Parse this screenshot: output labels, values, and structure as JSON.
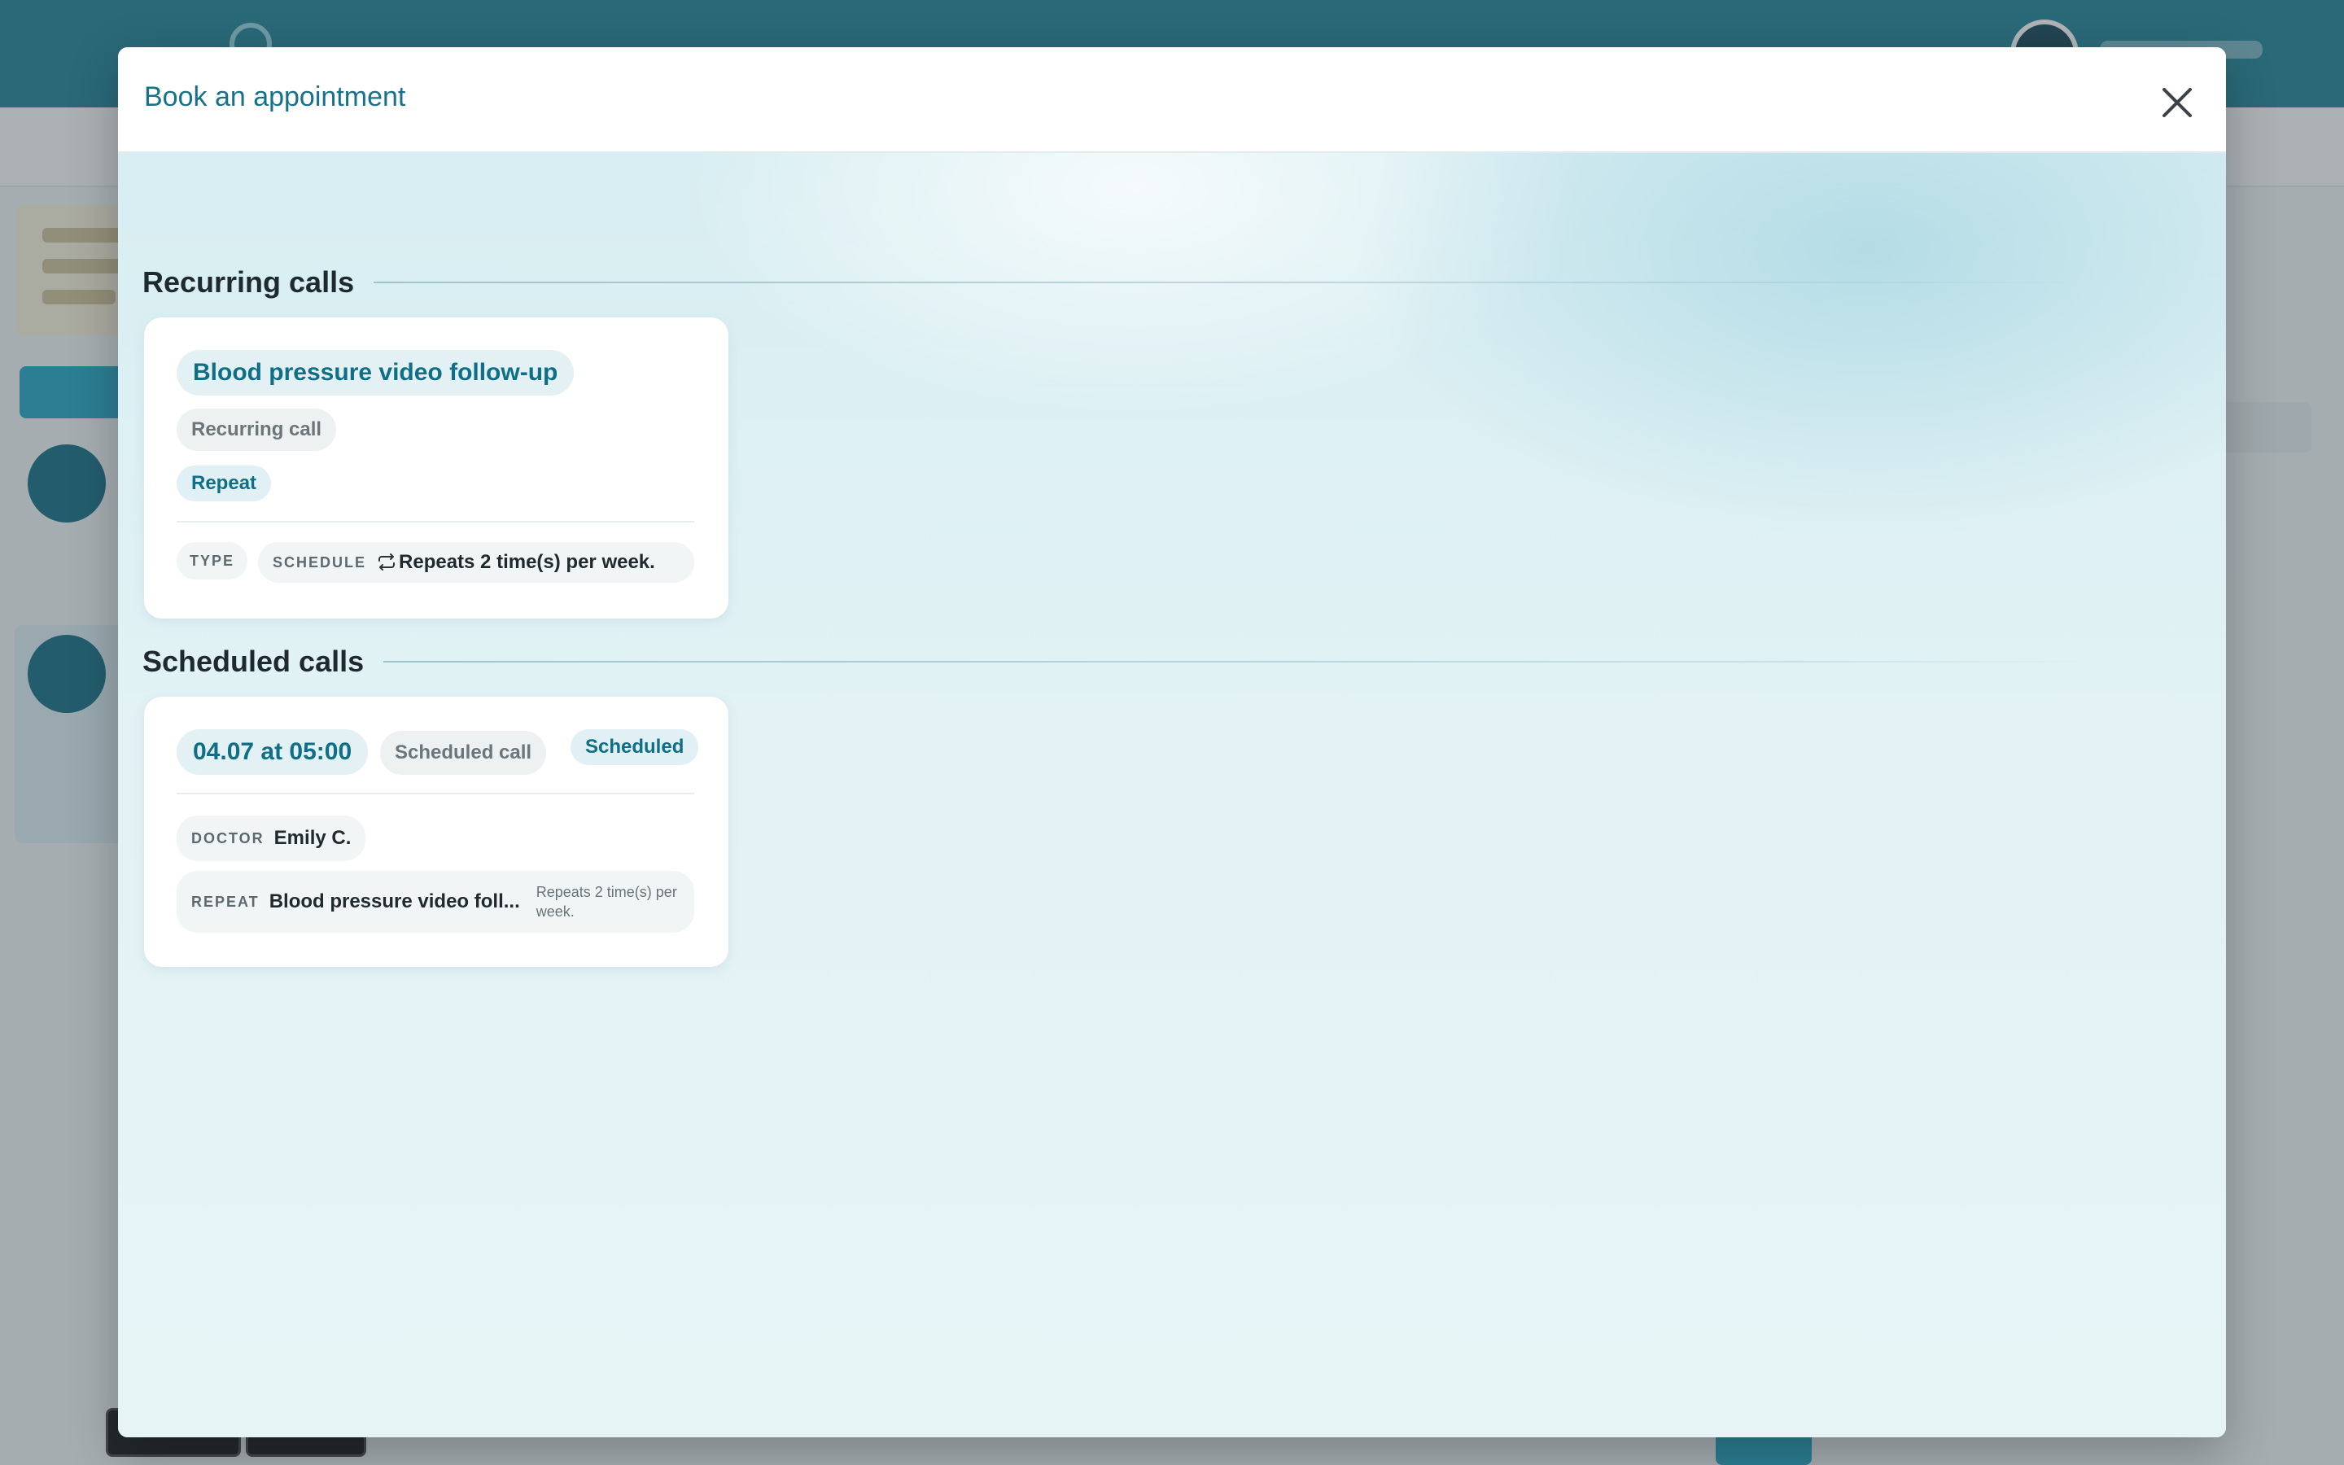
{
  "modal": {
    "title": "Book an appointment",
    "close_icon": "close-icon"
  },
  "recurring": {
    "section_title": "Recurring calls",
    "card": {
      "title": "Blood pressure video follow-up",
      "type_badge": "Recurring call",
      "status_badge": "Repeat",
      "type_label": "TYPE",
      "schedule_label": "SCHEDULE",
      "schedule_icon": "repeat-icon",
      "schedule_value": "Repeats 2 time(s) per week."
    }
  },
  "scheduled": {
    "section_title": "Scheduled calls",
    "card": {
      "datetime": "04.07 at 05:00",
      "type_badge": "Scheduled call",
      "status_badge": "Scheduled",
      "doctor_label": "DOCTOR",
      "doctor_value": "Emily C.",
      "repeat_label": "REPEAT",
      "repeat_value": "Blood pressure video foll...",
      "repeat_detail": "Repeats 2 time(s) per week."
    }
  },
  "colors": {
    "accent": "#16728a",
    "header_bg": "#1b7f93",
    "overlay": "rgba(64,76,84,0.42)"
  }
}
